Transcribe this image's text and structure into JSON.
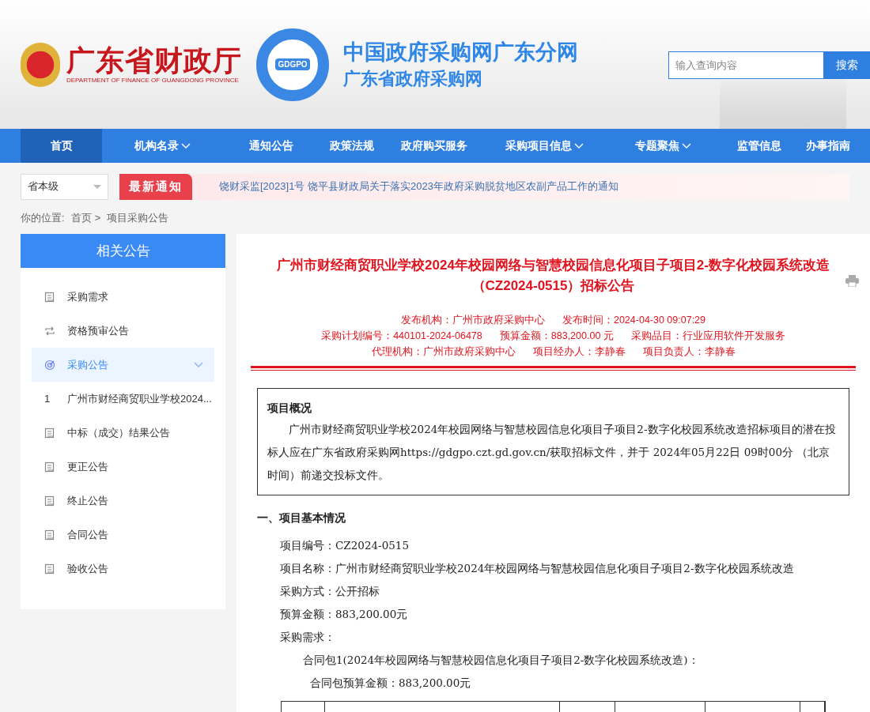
{
  "header": {
    "dept_name": "广东省财政厅",
    "dept_english": "DEPARTMENT OF FINANCE OF GUANGDONG PROVINCE",
    "logo_text": "GDGPO",
    "site_title": "中国政府采购网广东分网",
    "site_subtitle": "广东省政府采购网",
    "search": {
      "placeholder": "输入查询内容",
      "button": "搜索"
    }
  },
  "nav": [
    {
      "label": "首页",
      "selected": true,
      "dropdown": false
    },
    {
      "label": "机构名录",
      "selected": false,
      "dropdown": true
    },
    {
      "label": "通知公告",
      "selected": false,
      "dropdown": false
    },
    {
      "label": "政策法规",
      "selected": false,
      "dropdown": false
    },
    {
      "label": "政府购买服务",
      "selected": false,
      "dropdown": false
    },
    {
      "label": "采购项目信息",
      "selected": false,
      "dropdown": true
    },
    {
      "label": "专题聚焦",
      "selected": false,
      "dropdown": true
    },
    {
      "label": "监管信息",
      "selected": false,
      "dropdown": false
    },
    {
      "label": "办事指南",
      "selected": false,
      "dropdown": false
    }
  ],
  "notice_bar": {
    "region_select": "省本级",
    "badge": "最新通知",
    "notice": "饶财采监[2023]1号 饶平县财政局关于落实2023年政府采购脱贫地区农副产品工作的通知"
  },
  "breadcrumb": {
    "label": "你的位置:",
    "items": [
      "首页",
      "项目采购公告"
    ],
    "separator": ">"
  },
  "sidebar": {
    "title": "相关公告",
    "items": [
      {
        "kind": "category",
        "label": "采购需求",
        "selected": false,
        "expanded": false
      },
      {
        "kind": "category",
        "label": "资格预审公告",
        "selected": false,
        "expanded": false
      },
      {
        "kind": "category",
        "label": "采购公告",
        "selected": true,
        "expanded": true
      },
      {
        "kind": "entry",
        "number": "1",
        "label": "广州市财经商贸职业学校2024..."
      },
      {
        "kind": "category",
        "label": "中标（成交）结果公告",
        "selected": false,
        "expanded": false
      },
      {
        "kind": "category",
        "label": "更正公告",
        "selected": false,
        "expanded": false
      },
      {
        "kind": "category",
        "label": "终止公告",
        "selected": false,
        "expanded": false
      },
      {
        "kind": "category",
        "label": "合同公告",
        "selected": false,
        "expanded": false
      },
      {
        "kind": "category",
        "label": "验收公告",
        "selected": false,
        "expanded": false
      }
    ]
  },
  "article": {
    "title_lines": [
      "广州市财经商贸职业学校2024年校园网络与智慧校园信息化项目子项目2-数字化校园系统改造",
      "（CZ2024-0515）招标公告"
    ],
    "meta_rows": [
      [
        "发布机构：广州市政府采购中心",
        "发布时间：2024-04-30 09:07:29"
      ],
      [
        "采购计划编号：440101-2024-06478",
        "预算金额：883,200.00 元",
        "采购品目：行业应用软件开发服务"
      ],
      [
        "代理机构：广州市政府采购中心",
        "项目经办人：李静春",
        "项目负责人：李静春"
      ]
    ],
    "overview": {
      "heading": "项目概况",
      "text": "广州市财经商贸职业学校2024年校园网络与智慧校园信息化项目子项目2-数字化校园系统改造招标项目的潜在投标人应在广东省政府采购网https://gdgpo.czt.gd.gov.cn/获取招标文件，并于 2024年05月22日 09时00分 （北京时间）前递交投标文件。"
    },
    "section_heading": "一、项目基本情况",
    "lines": [
      {
        "text": "项目编号：CZ2024-0515"
      },
      {
        "text": "项目名称：广州市财经商贸职业学校2024年校园网络与智慧校园信息化项目子项目2-数字化校园系统改造"
      },
      {
        "text": "采购方式：公开招标"
      },
      {
        "text": "预算金额：883,200.00元"
      },
      {
        "text": "采购需求：",
        "children": [
          {
            "text": "合同包1(2024年校园网络与智慧校园信息化项目子项目2-数字化校园系统改造)：",
            "children": [
              {
                "text": "合同包预算金额：883,200.00元"
              }
            ]
          }
        ]
      }
    ]
  }
}
